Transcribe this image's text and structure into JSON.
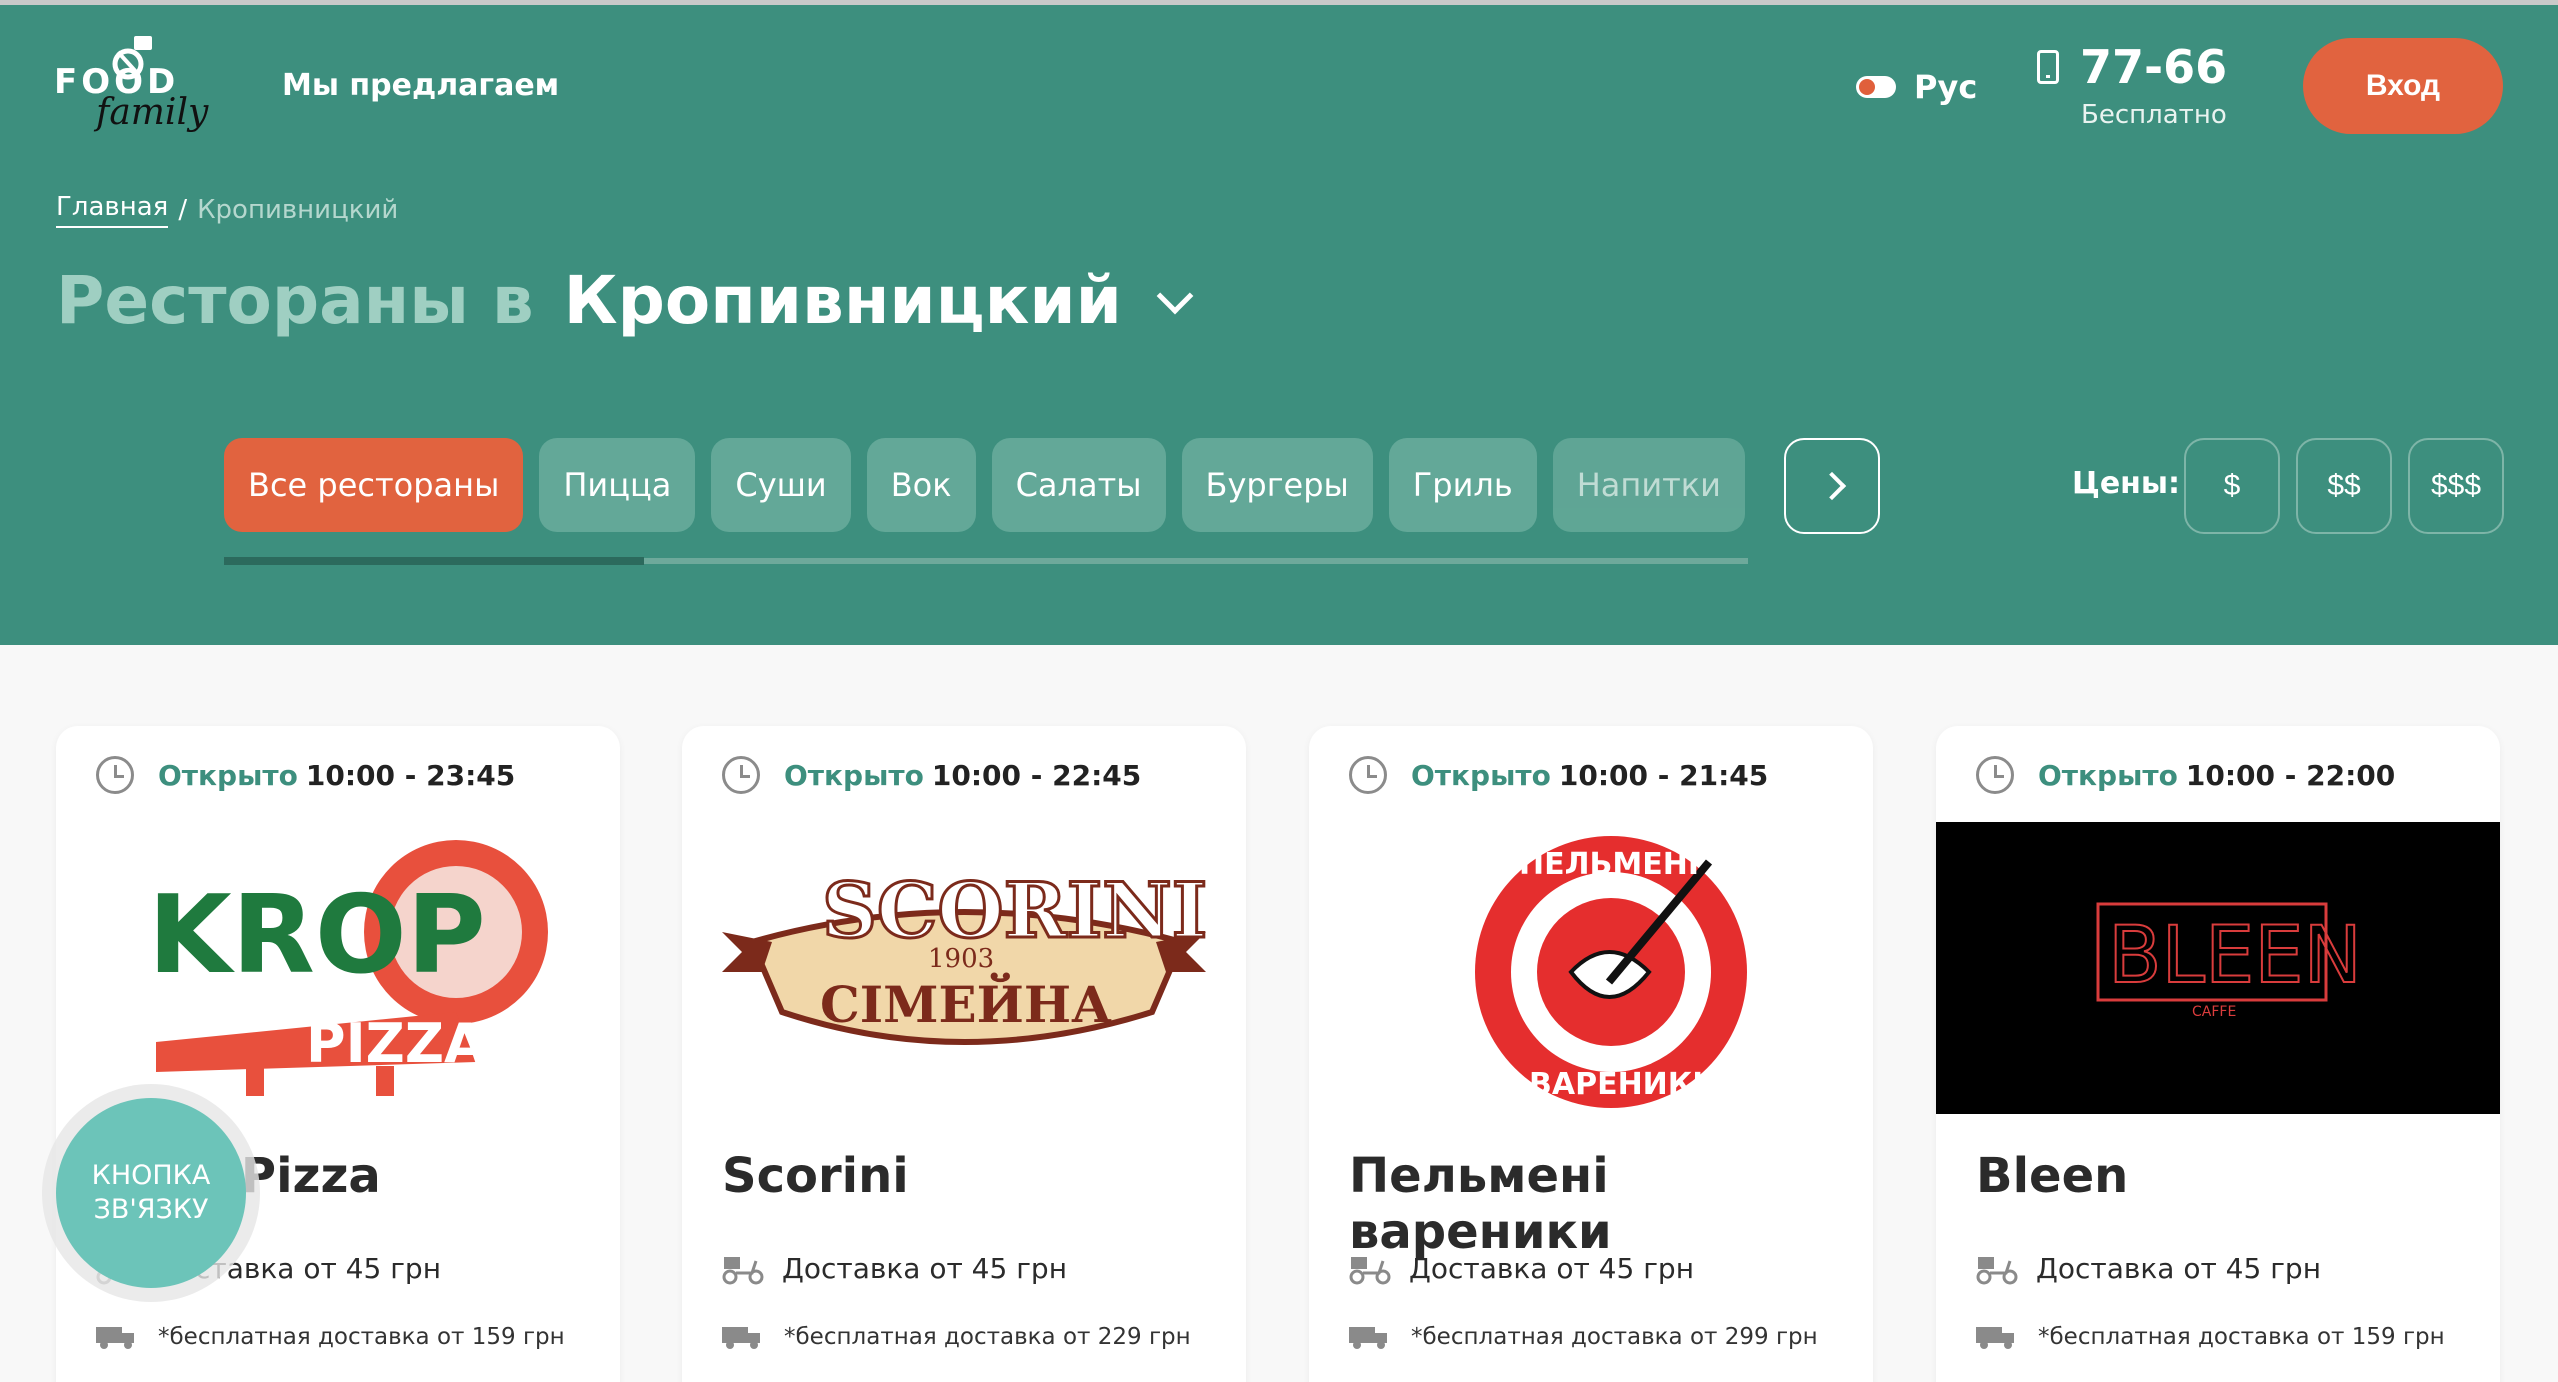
{
  "header": {
    "logo_text_top": "FOOD",
    "logo_text_bottom": "family",
    "nav_offer": "Мы предлагаем",
    "language": "Рус",
    "phone": "77-66",
    "phone_note": "Бесплатно",
    "login": "Вход"
  },
  "breadcrumb": {
    "home": "Главная",
    "separator": "/",
    "current": "Кропивницкий"
  },
  "title": {
    "prefix": "Рестораны в",
    "city": "Кропивницкий"
  },
  "categories": [
    {
      "label": "Все рестораны",
      "active": true
    },
    {
      "label": "Пицца"
    },
    {
      "label": "Суши"
    },
    {
      "label": "Вок"
    },
    {
      "label": "Салаты"
    },
    {
      "label": "Бургеры"
    },
    {
      "label": "Гриль"
    },
    {
      "label": "Напитки"
    }
  ],
  "prices": {
    "label": "Цены:",
    "options": [
      "$",
      "$$",
      "$$$"
    ]
  },
  "restaurants": [
    {
      "status": "Открыто",
      "hours": "10:00 - 23:45",
      "name": "Krop Pizza",
      "delivery": "Доставка от 45 грн",
      "free_delivery": "*бесплатная доставка от 159 грн",
      "logo_text": [
        "KROP",
        "PIZZA"
      ]
    },
    {
      "status": "Открыто",
      "hours": "10:00 - 22:45",
      "name": "Scorini",
      "delivery": "Доставка от 45 грн",
      "free_delivery": "*бесплатная доставка от 229 грн",
      "logo_text": [
        "SCORINI",
        "1903",
        "СІМЕЙНА"
      ]
    },
    {
      "status": "Открыто",
      "hours": "10:00 - 21:45",
      "name": "Пельмені вареники",
      "delivery": "Доставка от 45 грн",
      "free_delivery": "*бесплатная доставка от 299 грн",
      "logo_text": [
        "ПЕЛЬМЕНІ",
        "ВАРЕНИКИ"
      ]
    },
    {
      "status": "Открыто",
      "hours": "10:00 - 22:00",
      "name": "Bleen",
      "delivery": "Доставка от 45 грн",
      "free_delivery": "*бесплатная доставка от 159 грн",
      "logo_text": [
        "BLEEN",
        "CAFFE"
      ]
    }
  ],
  "contact_button": {
    "line1": "КНОПКА",
    "line2": "ЗВ'ЯЗКУ"
  },
  "colors": {
    "header_bg": "#3d8f7e",
    "accent": "#e1633f",
    "chip_bg": "#63a898"
  },
  "icons": {
    "phone": "phone-icon",
    "clock": "clock-icon",
    "scooter": "scooter-icon",
    "truck": "truck-icon",
    "chevron": "chevron-down-icon",
    "next": "chevron-right-icon"
  }
}
